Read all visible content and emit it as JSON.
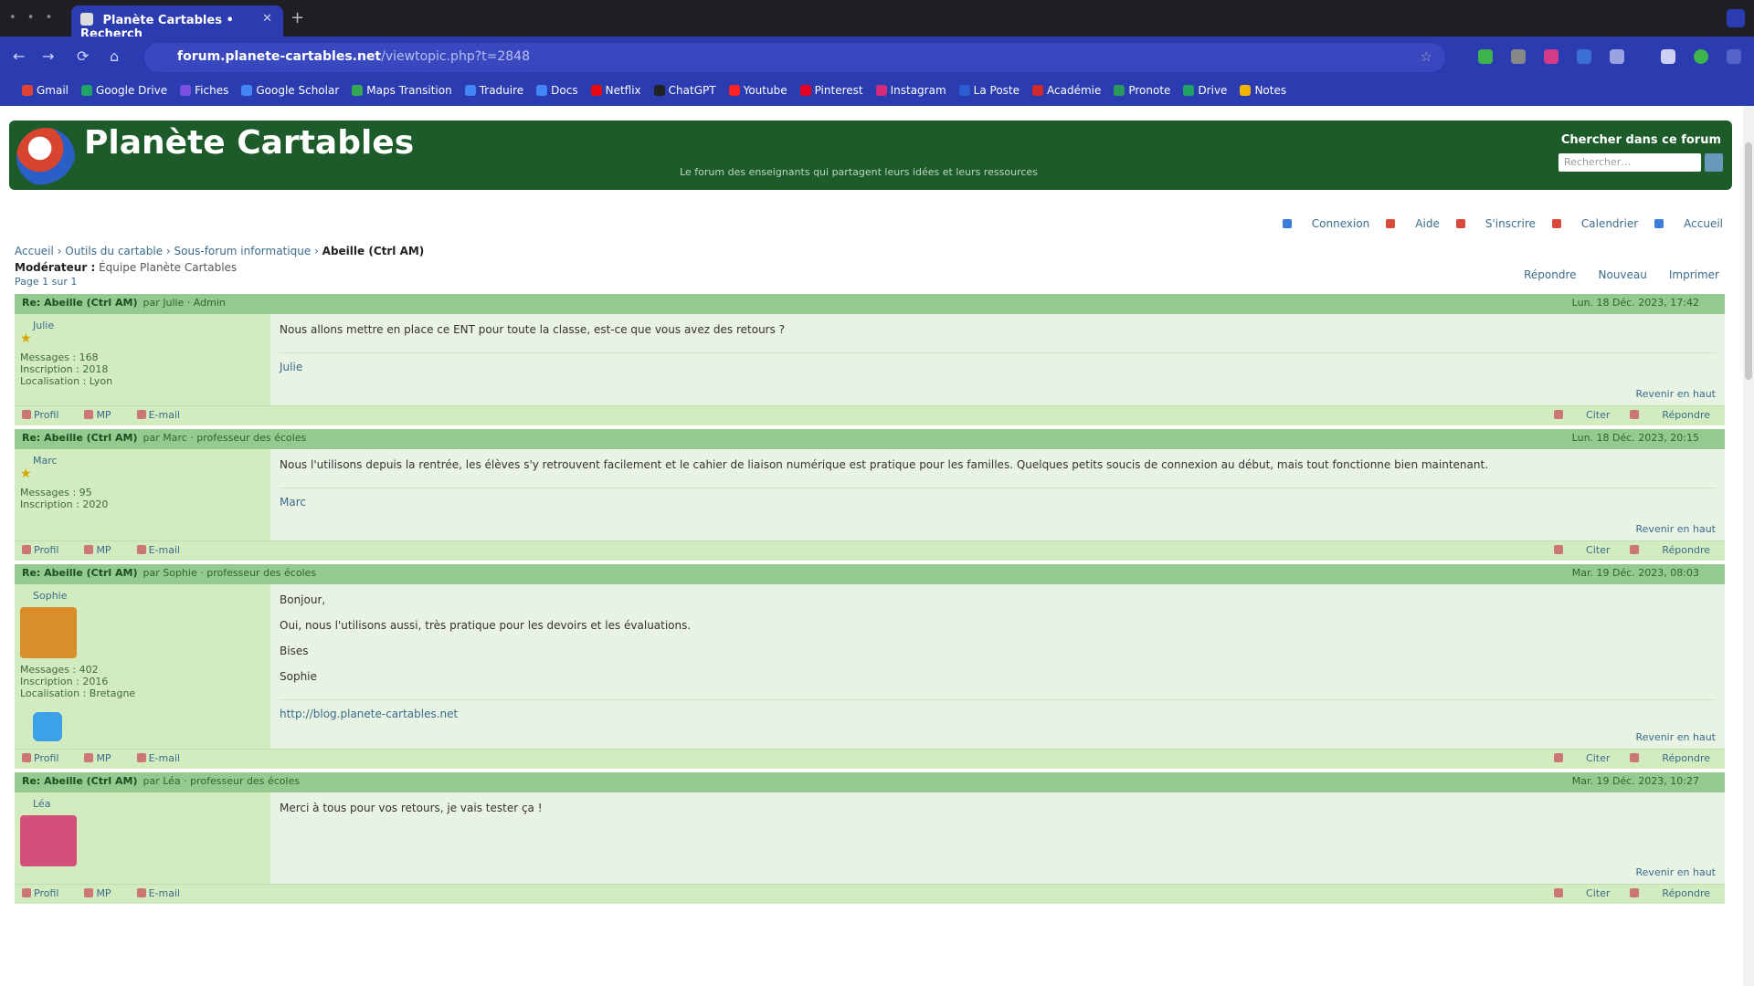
{
  "browser": {
    "tab_title": "Planète Cartables • Recherch",
    "url_host": "forum.planete-cartables.net",
    "url_path": "/viewtopic.php?t=2848",
    "window_controls": "• • •",
    "newtab": "+",
    "nav": {
      "back": "←",
      "forward": "→",
      "reload": "⟳",
      "home": "⌂"
    },
    "bookmarks": [
      {
        "label": "Gmail",
        "color": "#e34133"
      },
      {
        "label": "Google Drive",
        "color": "#1fa463"
      },
      {
        "label": "Fiches",
        "color": "#7b4fe0"
      },
      {
        "label": "Google Scholar",
        "color": "#4285f4"
      },
      {
        "label": "Maps Transition",
        "color": "#34a853"
      },
      {
        "label": "Traduire",
        "color": "#4285f4"
      },
      {
        "label": "Docs",
        "color": "#4285f4"
      },
      {
        "label": "Netflix",
        "color": "#e50914"
      },
      {
        "label": "ChatGPT",
        "color": "#222"
      },
      {
        "label": "Youtube",
        "color": "#ff2020"
      },
      {
        "label": "Pinterest",
        "color": "#e60023"
      },
      {
        "label": "Instagram",
        "color": "#d62976"
      },
      {
        "label": "La Poste",
        "color": "#2d5bd1"
      },
      {
        "label": "Académie",
        "color": "#d12a2a"
      },
      {
        "label": "Pronote",
        "color": "#2a9a5a"
      },
      {
        "label": "Drive",
        "color": "#1fa463"
      },
      {
        "label": "Notes",
        "color": "#f2b400"
      }
    ]
  },
  "site": {
    "title": "Planète Cartables",
    "tagline": "Le forum des enseignants qui partagent leurs idées et leurs ressources",
    "search_label": "Chercher dans ce forum",
    "search_placeholder": "Rechercher…",
    "userlinks": [
      {
        "label": "Connexion",
        "color": "#3b7dd8"
      },
      {
        "label": "Aide",
        "color": "#d84a3b"
      },
      {
        "label": "S'inscrire",
        "color": "#d84a3b"
      },
      {
        "label": "Calendrier",
        "color": "#d84a3b"
      },
      {
        "label": "Accueil",
        "color": "#3b7dd8"
      }
    ],
    "breadcrumb": {
      "items": [
        "Accueil",
        "Outils du cartable",
        "Sous-forum informatique"
      ],
      "current": "Abeille (Ctrl AM)"
    },
    "moderators_label": "Modérateur :",
    "moderators": "Équipe Planète Cartables",
    "pagenav": "Page 1 sur 1",
    "topic_buttons": [
      "Répondre",
      "Nouveau",
      "Imprimer"
    ]
  },
  "posts": [
    {
      "title": "Re: Abeille (Ctrl AM)",
      "by": "par Julie · Admin",
      "date": "Lun. 18 Déc. 2023, 17:42",
      "author": "Julie",
      "info": [
        "Messages : 168",
        "Inscription : 2018",
        "Localisation : Lyon"
      ],
      "body": [
        "Nous allons mettre en place ce ENT pour toute la classe, est-ce que vous avez des retours ?"
      ],
      "signature": "Julie",
      "has_avatar": false,
      "avatar_color": "",
      "rank": "★",
      "has_twitter": false
    },
    {
      "title": "Re: Abeille (Ctrl AM)",
      "by": "par Marc · professeur des écoles",
      "date": "Lun. 18 Déc. 2023, 20:15",
      "author": "Marc",
      "info": [
        "Messages : 95",
        "Inscription : 2020"
      ],
      "body": [
        "Nous l'utilisons depuis la rentrée, les élèves s'y retrouvent facilement et le cahier de liaison numérique est pratique pour les familles. Quelques petits soucis de connexion au début, mais tout fonctionne bien maintenant."
      ],
      "signature": "Marc",
      "has_avatar": false,
      "avatar_color": "",
      "rank": "★",
      "has_twitter": false
    },
    {
      "title": "Re: Abeille (Ctrl AM)",
      "by": "par Sophie · professeur des écoles",
      "date": "Mar. 19 Déc. 2023, 08:03",
      "author": "Sophie",
      "info": [
        "Messages : 402",
        "Inscription : 2016",
        "Localisation : Bretagne"
      ],
      "body": [
        "Bonjour,",
        "Oui, nous l'utilisons aussi, très pratique pour les devoirs et les évaluations.",
        "Bises",
        "Sophie"
      ],
      "signature": "http://blog.planete-cartables.net",
      "has_avatar": true,
      "avatar_color": "#d98e2a",
      "rank": "",
      "has_twitter": true
    },
    {
      "title": "Re: Abeille (Ctrl AM)",
      "by": "par Léa · professeur des écoles",
      "date": "Mar. 19 Déc. 2023, 10:27",
      "author": "Léa",
      "info": [],
      "body": [
        "Merci à tous pour vos retours, je vais tester ça !"
      ],
      "signature": "",
      "has_avatar": true,
      "avatar_color": "#d2507a",
      "rank": "",
      "has_twitter": false
    }
  ],
  "post_footer": {
    "left": [
      "Profil",
      "MP",
      "E-mail"
    ],
    "right": [
      "Citer",
      "Répondre"
    ],
    "prefs": "Revenir en haut"
  }
}
